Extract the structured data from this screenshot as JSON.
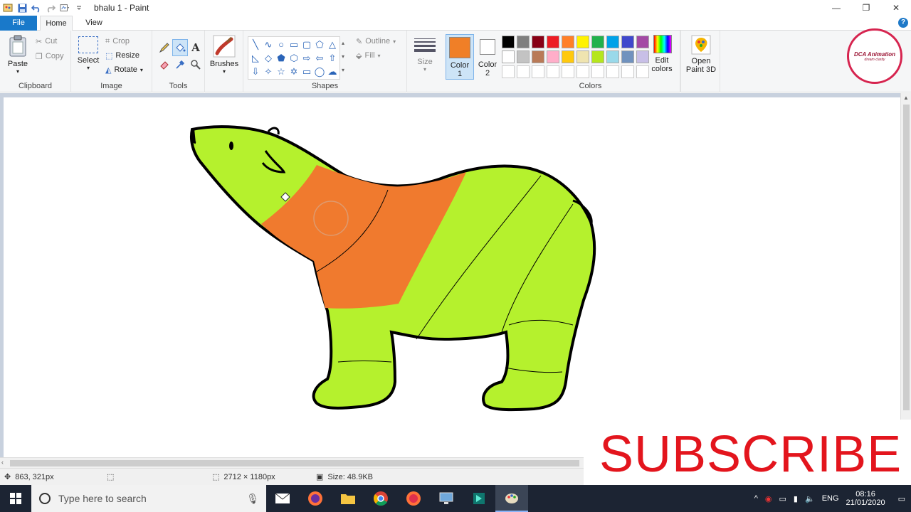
{
  "window": {
    "title": "bhalu 1 - Paint",
    "minimize": "—",
    "restore": "❐",
    "close": "✕"
  },
  "tabs": {
    "file": "File",
    "home": "Home",
    "view": "View"
  },
  "ribbon": {
    "clipboard": {
      "label": "Clipboard",
      "paste": "Paste",
      "cut": "Cut",
      "copy": "Copy"
    },
    "image": {
      "label": "Image",
      "select": "Select",
      "crop": "Crop",
      "resize": "Resize",
      "rotate": "Rotate"
    },
    "tools": {
      "label": "Tools"
    },
    "brushes": {
      "label": "Brushes"
    },
    "shapes": {
      "label": "Shapes",
      "outline": "Outline",
      "fill": "Fill"
    },
    "size": {
      "label": "Size"
    },
    "color1": {
      "label": "Color",
      "sub": "1",
      "value": "#f07f27"
    },
    "color2": {
      "label": "Color",
      "sub": "2",
      "value": "#ffffff"
    },
    "colors": {
      "label": "Colors",
      "edit": "Edit colors",
      "row1": [
        "#000000",
        "#7f7f7f",
        "#880015",
        "#ed1c24",
        "#ff7f27",
        "#fff200",
        "#22b14c",
        "#00a2e8",
        "#3f48cc",
        "#a349a4"
      ],
      "row2": [
        "#ffffff",
        "#c3c3c3",
        "#b97a57",
        "#ffaec9",
        "#ffc90e",
        "#efe4b0",
        "#b5e61d",
        "#99d9ea",
        "#7092be",
        "#c8bfe7"
      ],
      "row3": [
        "#ffffff",
        "#ffffff",
        "#ffffff",
        "#ffffff",
        "#ffffff",
        "#ffffff",
        "#ffffff",
        "#ffffff",
        "#ffffff",
        "#ffffff"
      ]
    },
    "paint3d": {
      "label": "Open Paint 3D"
    }
  },
  "drawing": {
    "bear_body_color": "#b5f12d",
    "bear_band_color": "#f07a2e",
    "outline_color": "#000000"
  },
  "statusbar": {
    "cursor": "863, 321px",
    "dimensions": "2712 × 1180px",
    "size": "Size: 48.9KB"
  },
  "overlay": {
    "subscribe": "SUBSCRIBE",
    "logo_title": "DCA Animation",
    "logo_sub": "dream·clarity"
  },
  "taskbar": {
    "search_placeholder": "Type here to search",
    "lang": "ENG",
    "time": "08:16",
    "date": "21/01/2020"
  }
}
